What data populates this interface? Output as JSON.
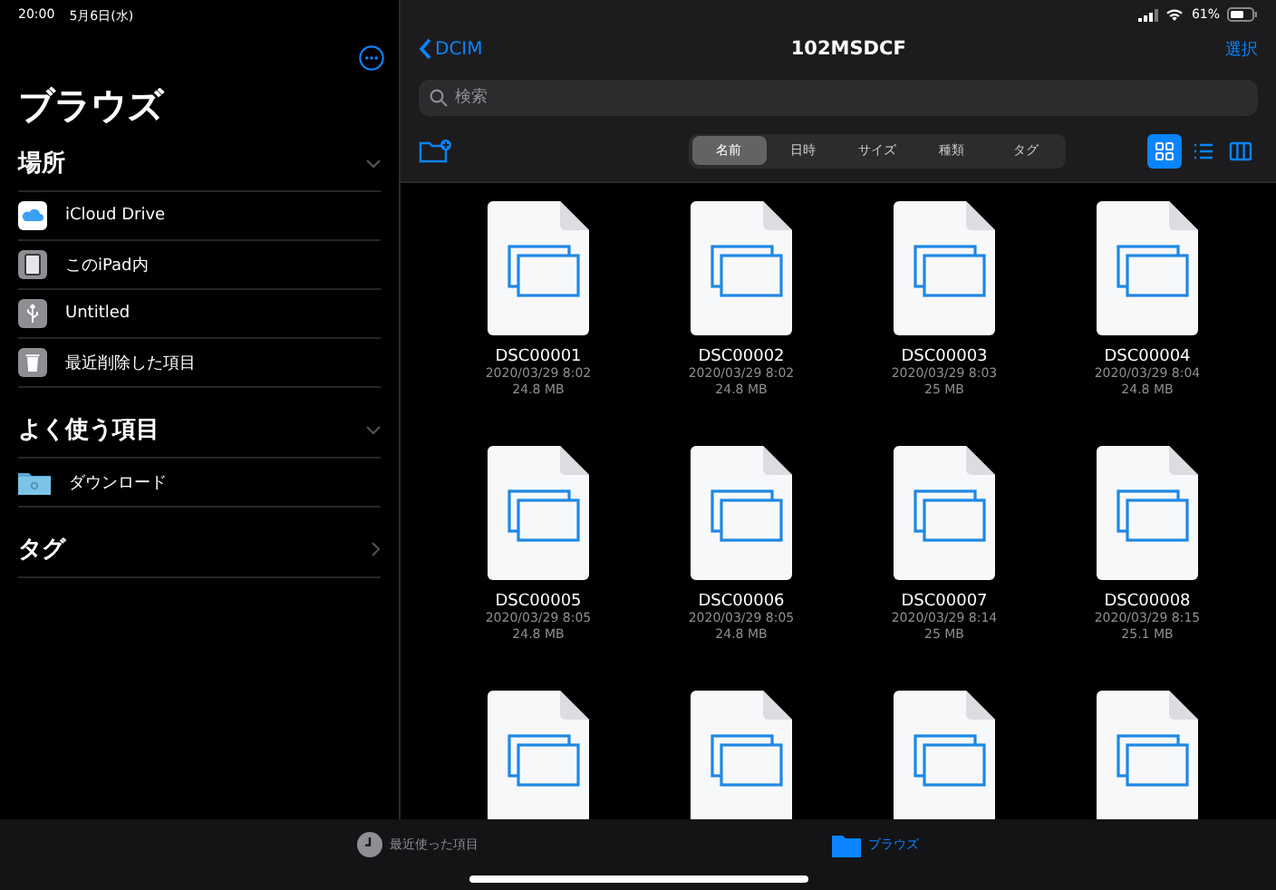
{
  "status_bar": {
    "time": "20:00",
    "date": "5月6日(水)",
    "battery": "61%"
  },
  "sidebar": {
    "title": "ブラウズ",
    "sections": [
      {
        "title": "場所",
        "expanded": true,
        "items": [
          {
            "label": "iCloud Drive",
            "kind": "cloud"
          },
          {
            "label": "このiPad内",
            "kind": "ipad"
          },
          {
            "label": "Untitled",
            "kind": "usb"
          },
          {
            "label": "最近削除した項目",
            "kind": "trash"
          }
        ]
      },
      {
        "title": "よく使う項目",
        "expanded": true,
        "items": [
          {
            "label": "ダウンロード",
            "kind": "folder"
          }
        ]
      },
      {
        "title": "タグ",
        "expanded": false
      }
    ]
  },
  "navigation": {
    "back": "DCIM",
    "title": "102MSDCF",
    "action": "選択"
  },
  "search": {
    "placeholder": "検索"
  },
  "sort_tabs": [
    {
      "label": "名前",
      "selected": true
    },
    {
      "label": "日時",
      "selected": false
    },
    {
      "label": "サイズ",
      "selected": false
    },
    {
      "label": "種類",
      "selected": false
    },
    {
      "label": "タグ",
      "selected": false
    }
  ],
  "view_modes": [
    {
      "kind": "grid",
      "selected": true
    },
    {
      "kind": "list",
      "selected": false
    },
    {
      "kind": "columns",
      "selected": false
    }
  ],
  "files": [
    {
      "kind": "document",
      "name": "DSC00001",
      "date": "2020/03/29 8:02",
      "size": "24.8 MB"
    },
    {
      "kind": "document",
      "name": "DSC00002",
      "date": "2020/03/29 8:02",
      "size": "24.8 MB"
    },
    {
      "kind": "document",
      "name": "DSC00003",
      "date": "2020/03/29 8:03",
      "size": "25 MB"
    },
    {
      "kind": "document",
      "name": "DSC00004",
      "date": "2020/03/29 8:04",
      "size": "24.8 MB"
    },
    {
      "kind": "document",
      "name": "DSC00005",
      "date": "2020/03/29 8:05",
      "size": "24.8 MB"
    },
    {
      "kind": "document",
      "name": "DSC00006",
      "date": "2020/03/29 8:05",
      "size": "24.8 MB"
    },
    {
      "kind": "document",
      "name": "DSC00007",
      "date": "2020/03/29 8:14",
      "size": "25 MB"
    },
    {
      "kind": "document",
      "name": "DSC00008",
      "date": "2020/03/29 8:15",
      "size": "25.1 MB"
    },
    {
      "kind": "document"
    },
    {
      "kind": "document"
    },
    {
      "kind": "document"
    },
    {
      "kind": "document"
    }
  ],
  "tab_bar": [
    {
      "label": "最近使った項目",
      "kind": "recents",
      "selected": false
    },
    {
      "label": "ブラウズ",
      "kind": "browse",
      "selected": true
    }
  ]
}
